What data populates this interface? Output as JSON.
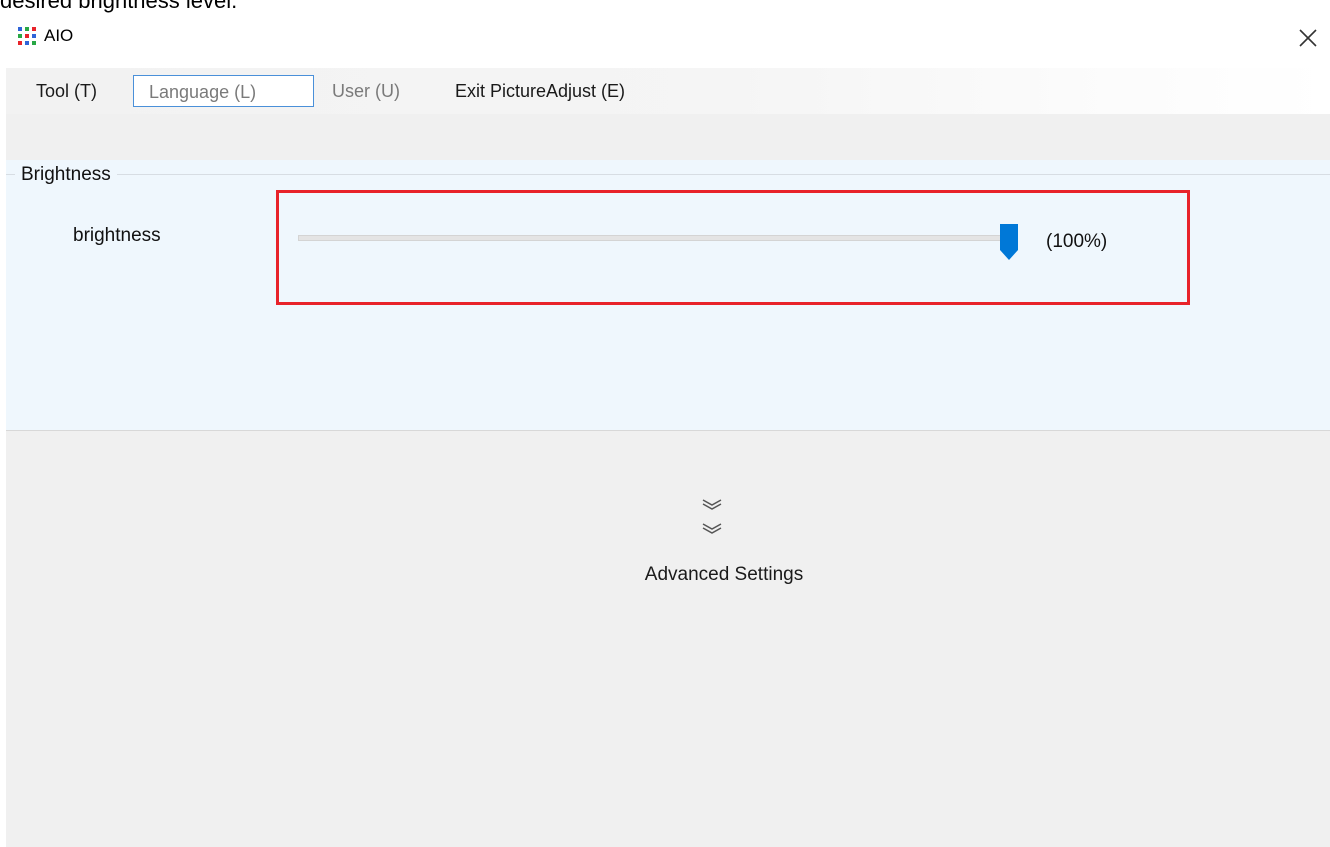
{
  "caption": {
    "text": "desired brightness level."
  },
  "window": {
    "title": "AIO",
    "icon": "app-grid-icon",
    "close_icon": "close-icon"
  },
  "menu": {
    "items": [
      {
        "label": "Tool (T)",
        "enabled": true
      },
      {
        "label": "Language (L)",
        "enabled": false,
        "focused": true
      },
      {
        "label": "User (U)",
        "enabled": false
      },
      {
        "label": "Exit PictureAdjust (E)",
        "enabled": true
      }
    ]
  },
  "brightness_group": {
    "title": "Brightness",
    "slider": {
      "label": "brightness",
      "value_text": "(100%)",
      "value_percent": 100
    }
  },
  "advanced": {
    "label": "Advanced Settings",
    "icon": "double-chevron-down-icon"
  },
  "colors": {
    "highlight": "#e8232a",
    "accent": "#0078d7",
    "panel_bg": "#eff7fd",
    "window_bg": "#f0f0f0",
    "focus_border": "#4a90d9"
  }
}
